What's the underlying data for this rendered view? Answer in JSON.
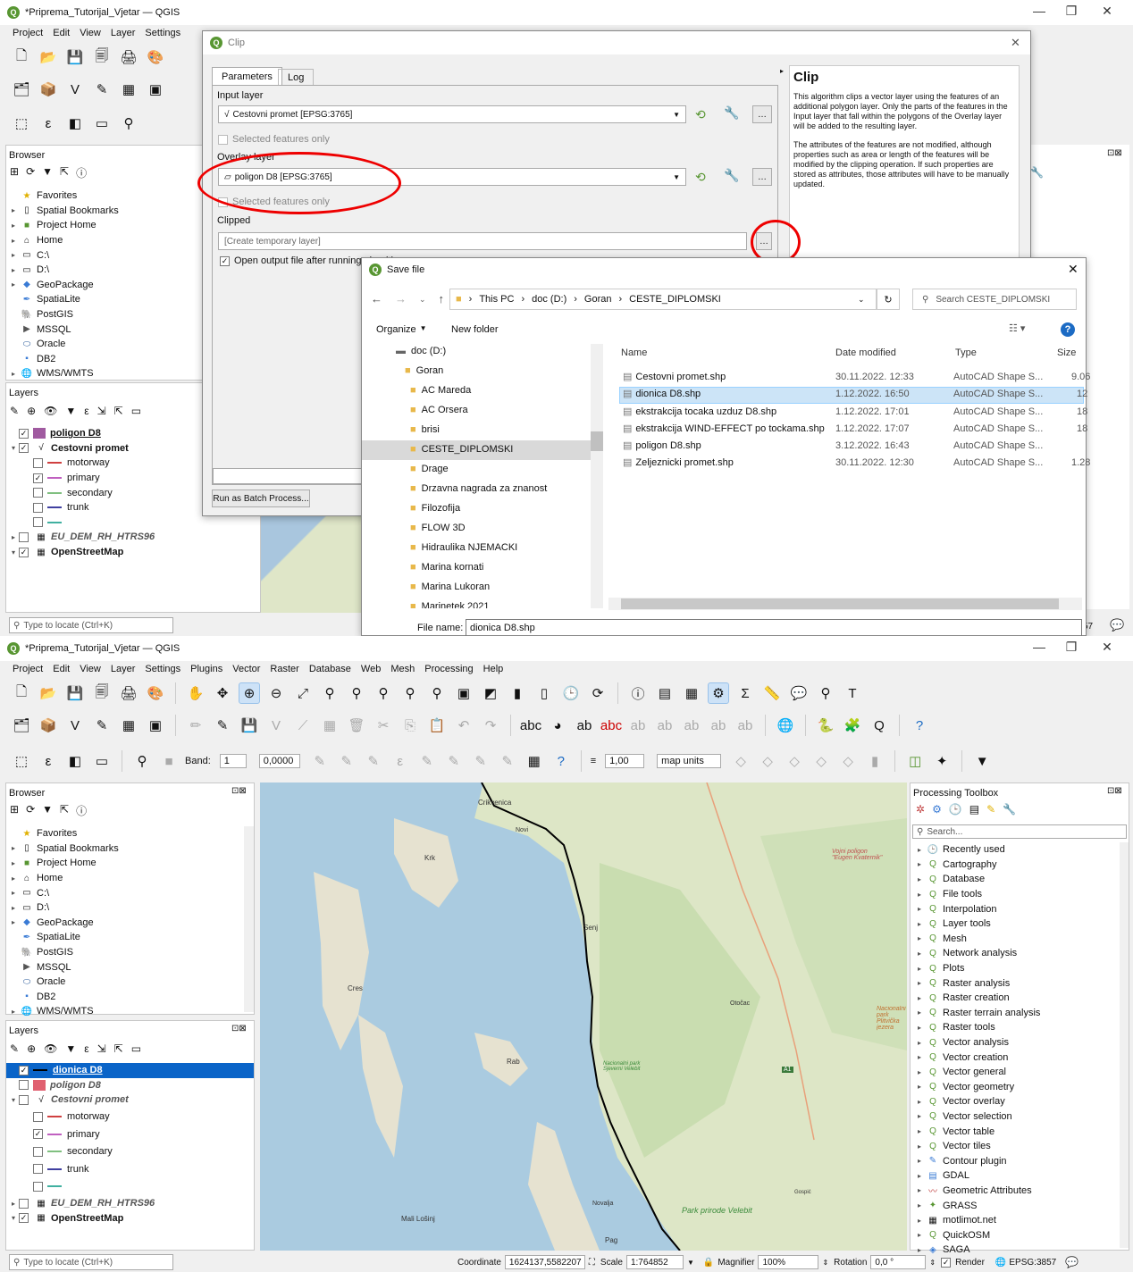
{
  "top": {
    "title": "*Priprema_Tutorijal_Vjetar — QGIS",
    "menu": [
      "Project",
      "Edit",
      "View",
      "Layer",
      "Settings"
    ],
    "browser_title": "Browser",
    "browser_items": [
      "Favorites",
      "Spatial Bookmarks",
      "Project Home",
      "Home",
      "C:\\",
      "D:\\",
      "GeoPackage",
      "SpatiaLite",
      "PostGIS",
      "MSSQL",
      "Oracle",
      "DB2",
      "WMS/WMTS"
    ],
    "layers_title": "Layers",
    "layers": {
      "l1": "poligon D8",
      "l2": "Cestovni promet",
      "s1": "motorway",
      "s2": "primary",
      "s3": "secondary",
      "s4": "trunk",
      "l3": "EU_DEM_RH_HTRS96",
      "l4": "OpenStreetMap"
    },
    "locate": "Type to locate (Ctrl+K)",
    "status_partial": "57"
  },
  "clip": {
    "title": "Clip",
    "tab_params": "Parameters",
    "tab_log": "Log",
    "input_label": "Input layer",
    "input_value": "Cestovni promet [EPSG:3765]",
    "selected1": "Selected features only",
    "overlay_label": "Overlay layer",
    "overlay_value": "poligon D8 [EPSG:3765]",
    "selected2": "Selected features only",
    "clipped_label": "Clipped",
    "clipped_placeholder": "[Create temporary layer]",
    "open_output": "Open output file after running algorithm",
    "batch_button": "Run as Batch Process...",
    "help_title": "Clip",
    "help_p1": "This algorithm clips a vector layer using the features of an additional polygon layer. Only the parts of the features in the Input layer that fall within the polygons of the Overlay layer will be added to the resulting layer.",
    "help_p2": "The attributes of the features are not modified, although properties such as area or length of the features will be modified by the clipping operation. If such properties are stored as attributes, those attributes will have to be manually updated."
  },
  "save": {
    "title": "Save file",
    "path": [
      "This PC",
      "doc (D:)",
      "Goran",
      "CESTE_DIPLOMSKI"
    ],
    "search_placeholder": "Search CESTE_DIPLOMSKI",
    "organize": "Organize",
    "new_folder": "New folder",
    "folders": [
      "doc (D:)",
      "Goran",
      "AC Mareda",
      "AC Orsera",
      "brisi",
      "CESTE_DIPLOMSKI",
      "Drage",
      "Drzavna nagrada za znanost",
      "Filozofija",
      "FLOW 3D",
      "Hidraulika NJEMACKI",
      "Marina kornati",
      "Marina Lukoran",
      "Marinetek 2021"
    ],
    "col_name": "Name",
    "col_date": "Date modified",
    "col_type": "Type",
    "col_size": "Size",
    "files": [
      {
        "name": "Cestovni promet.shp",
        "date": "30.11.2022. 12:33",
        "type": "AutoCAD Shape S...",
        "size": "9.06"
      },
      {
        "name": "dionica D8.shp",
        "date": "1.12.2022. 16:50",
        "type": "AutoCAD Shape S...",
        "size": "12"
      },
      {
        "name": "ekstrakcija tocaka uzduz D8.shp",
        "date": "1.12.2022. 17:01",
        "type": "AutoCAD Shape S...",
        "size": "18"
      },
      {
        "name": "ekstrakcija WIND-EFFECT po tockama.shp",
        "date": "1.12.2022. 17:07",
        "type": "AutoCAD Shape S...",
        "size": "18"
      },
      {
        "name": "poligon D8.shp",
        "date": "3.12.2022. 16:43",
        "type": "AutoCAD Shape S...",
        "size": ""
      },
      {
        "name": "Zeljeznicki promet.shp",
        "date": "30.11.2022. 12:30",
        "type": "AutoCAD Shape S...",
        "size": "1.28"
      }
    ],
    "file_name_label": "File name:",
    "file_name_value": "dionica D8.shp"
  },
  "bottom": {
    "title": "*Priprema_Tutorijal_Vjetar — QGIS",
    "menu": [
      "Project",
      "Edit",
      "View",
      "Layer",
      "Settings",
      "Plugins",
      "Vector",
      "Raster",
      "Database",
      "Web",
      "Mesh",
      "Processing",
      "Help"
    ],
    "band_label": "Band:",
    "band_value": "1",
    "zero_value": "0,0000",
    "width_value": "1,00",
    "units": "map units",
    "browser_title": "Browser",
    "browser_items": [
      "Favorites",
      "Spatial Bookmarks",
      "Project Home",
      "Home",
      "C:\\",
      "D:\\",
      "GeoPackage",
      "SpatiaLite",
      "PostGIS",
      "MSSQL",
      "Oracle",
      "DB2",
      "WMS/WMTS"
    ],
    "layers_title": "Layers",
    "layers": {
      "l0": "dionica D8",
      "l1": "poligon D8",
      "l2": "Cestovni promet",
      "s1": "motorway",
      "s2": "primary",
      "s3": "secondary",
      "s4": "trunk",
      "l3": "EU_DEM_RH_HTRS96",
      "l4": "OpenStreetMap"
    },
    "toolbox_title": "Processing Toolbox",
    "toolbox_search": "Search...",
    "toolbox": [
      "Recently used",
      "Cartography",
      "Database",
      "File tools",
      "Interpolation",
      "Layer tools",
      "Mesh",
      "Network analysis",
      "Plots",
      "Raster analysis",
      "Raster creation",
      "Raster terrain analysis",
      "Raster tools",
      "Vector analysis",
      "Vector creation",
      "Vector general",
      "Vector geometry",
      "Vector overlay",
      "Vector selection",
      "Vector table",
      "Vector tiles",
      "Contour plugin",
      "GDAL",
      "Geometric Attributes",
      "GRASS",
      "motlimot.net",
      "QuickOSM",
      "SAGA"
    ],
    "map_labels": {
      "cr": "Crikvenica",
      "kr": "Krk",
      "no": "Novi",
      "se": "Senj",
      "cr2": "Cres",
      "ra": "Rab",
      "ml": "Mali Lošinj",
      "pa": "Pag",
      "no2": "Novalja",
      "vel": "Park prirode Velebit",
      "npsv": "Nacionalni park Sjeverni Velebit",
      "oto": "Otočac",
      "gos": "Gospić",
      "vv": "Vojni poligon \"Eugen Kvaternik\"",
      "npp": "Nacionalni park Plitvička jezera",
      "a1": "A1"
    },
    "locate": "Type to locate (Ctrl+K)",
    "coord_label": "Coordinate",
    "coord_value": "1624137,5582207",
    "scale_label": "Scale",
    "scale_value": "1:764852",
    "magnifier_label": "Magnifier",
    "magnifier_value": "100%",
    "rotation_label": "Rotation",
    "rotation_value": "0,0 °",
    "render_label": "Render",
    "crs": "EPSG:3857"
  }
}
